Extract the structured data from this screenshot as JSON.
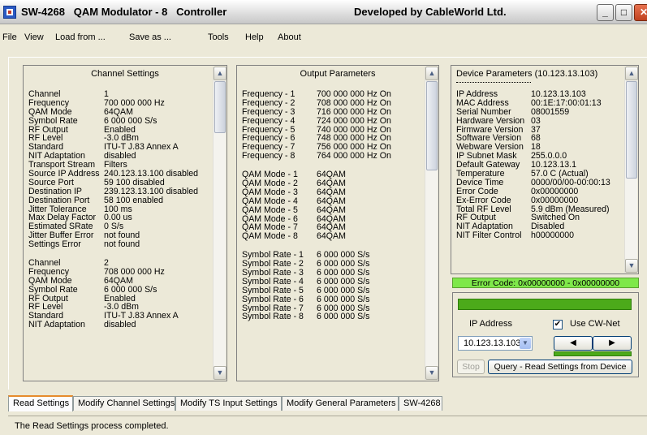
{
  "window": {
    "title_model": "SW-4268",
    "title_name": "QAM Modulator - 8   Controller",
    "title_developer": "Developed by CableWorld Ltd."
  },
  "menu": [
    "File",
    "View",
    "Load from ...",
    "Save as ...",
    "Tools",
    "Help",
    "About"
  ],
  "channel_settings": {
    "heading": "Channel Settings",
    "groups": [
      [
        [
          "Channel",
          "1"
        ],
        [
          "Frequency",
          "700 000 000 Hz"
        ],
        [
          "QAM Mode",
          "64QAM"
        ],
        [
          "Symbol Rate",
          "6 000 000 S/s"
        ],
        [
          "RF Output",
          "Enabled"
        ],
        [
          "RF Level",
          "-3.0 dBm"
        ],
        [
          "Standard",
          "ITU-T J.83 Annex A"
        ],
        [
          "NIT Adaptation",
          "disabled"
        ],
        [
          "Transport Stream",
          "Filters"
        ],
        [
          "Source IP Address",
          "240.123.13.100 disabled"
        ],
        [
          "Source Port",
          "59 100 disabled"
        ],
        [
          "Destination IP",
          "239.123.13.100 disabled"
        ],
        [
          "Destination Port",
          "58 100 enabled"
        ],
        [
          "Jitter Tolerance",
          "100 ms"
        ],
        [
          "Max Delay Factor",
          "0.00 us"
        ],
        [
          "Estimated SRate",
          "0 S/s"
        ],
        [
          "Jitter Buffer Error",
          "not found"
        ],
        [
          "Settings Error",
          "not found"
        ]
      ],
      [
        [
          "Channel",
          "2"
        ],
        [
          "Frequency",
          "708 000 000 Hz"
        ],
        [
          "QAM Mode",
          "64QAM"
        ],
        [
          "Symbol Rate",
          "6 000 000 S/s"
        ],
        [
          "RF Output",
          "Enabled"
        ],
        [
          "RF Level",
          "-3.0 dBm"
        ],
        [
          "Standard",
          "ITU-T J.83 Annex A"
        ],
        [
          "NIT Adaptation",
          "disabled"
        ]
      ]
    ]
  },
  "output_parameters": {
    "heading": "Output Parameters",
    "groups": [
      [
        [
          "Frequency - 1",
          "700 000 000 Hz  On"
        ],
        [
          "Frequency - 2",
          "708 000 000 Hz  On"
        ],
        [
          "Frequency - 3",
          "716 000 000 Hz  On"
        ],
        [
          "Frequency - 4",
          "724 000 000 Hz  On"
        ],
        [
          "Frequency - 5",
          "740 000 000 Hz  On"
        ],
        [
          "Frequency - 6",
          "748 000 000 Hz  On"
        ],
        [
          "Frequency - 7",
          "756 000 000 Hz  On"
        ],
        [
          "Frequency - 8",
          "764 000 000 Hz  On"
        ]
      ],
      [
        [
          "QAM Mode - 1",
          "64QAM"
        ],
        [
          "QAM Mode - 2",
          "64QAM"
        ],
        [
          "QAM Mode - 3",
          "64QAM"
        ],
        [
          "QAM Mode - 4",
          "64QAM"
        ],
        [
          "QAM Mode - 5",
          "64QAM"
        ],
        [
          "QAM Mode - 6",
          "64QAM"
        ],
        [
          "QAM Mode - 7",
          "64QAM"
        ],
        [
          "QAM Mode - 8",
          "64QAM"
        ]
      ],
      [
        [
          "Symbol Rate - 1",
          "6 000 000 S/s"
        ],
        [
          "Symbol Rate - 2",
          "6 000 000 S/s"
        ],
        [
          "Symbol Rate - 3",
          "6 000 000 S/s"
        ],
        [
          "Symbol Rate - 4",
          "6 000 000 S/s"
        ],
        [
          "Symbol Rate - 5",
          "6 000 000 S/s"
        ],
        [
          "Symbol Rate - 6",
          "6 000 000 S/s"
        ],
        [
          "Symbol Rate - 7",
          "6 000 000 S/s"
        ],
        [
          "Symbol Rate - 8",
          "6 000 000 S/s"
        ]
      ]
    ]
  },
  "device_parameters": {
    "heading": "Device Parameters  (10.123.13.103)",
    "rows": [
      [
        "IP Address",
        "10.123.13.103"
      ],
      [
        "MAC Address",
        "00:1E:17:00:01:13"
      ],
      [
        "Serial Number",
        "08001559"
      ],
      [
        "Hardware Version",
        "03"
      ],
      [
        "Firmware Version",
        "37"
      ],
      [
        "Software Version",
        "68"
      ],
      [
        "Webware Version",
        "18"
      ],
      [
        "IP Subnet Mask",
        "255.0.0.0"
      ],
      [
        "Default Gateway",
        "10.123.13.1"
      ],
      [
        "Temperature",
        "57.0 C (Actual)"
      ],
      [
        "Device Time",
        "0000/00/00-00:00:13"
      ],
      [
        "Error Code",
        "0x00000000"
      ],
      [
        "Ex-Error Code",
        "0x00000000"
      ],
      [
        "Total RF Level",
        "5.9 dBm (Measured)"
      ],
      [
        "RF Output",
        "Switched On"
      ],
      [
        "NIT Adaptation",
        "Disabled"
      ],
      [
        "NIT Filter Control",
        "h00000000"
      ]
    ]
  },
  "error_code_text": "Error Code: 0x00000000 - 0x00000000",
  "controls": {
    "ip_label": "IP Address",
    "use_cw_net_label": "Use CW-Net",
    "use_cw_net_checked": true,
    "ip_value": "10.123.13.103",
    "stop_label": "Stop",
    "query_label": "Query - Read Settings from Device"
  },
  "tabs": [
    "Read Settings",
    "Modify Channel Settings",
    "Modify TS Input Settings",
    "Modify General Parameters",
    "SW-4268"
  ],
  "active_tab": 0,
  "status_text": "The Read Settings process completed."
}
